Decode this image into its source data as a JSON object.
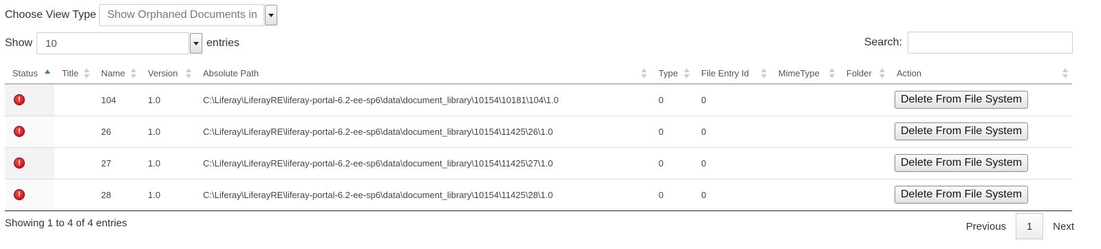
{
  "view_type": {
    "label": "Choose View Type",
    "selected": "Show Orphaned Documents in"
  },
  "length_menu": {
    "show_label": "Show",
    "selected": "10",
    "entries_label": "entries"
  },
  "search": {
    "label": "Search:",
    "value": ""
  },
  "table": {
    "columns": [
      "Status",
      "Title",
      "Name",
      "Version",
      "Absolute Path",
      "Type",
      "File Entry Id",
      "MimeType",
      "Folder",
      "Action"
    ],
    "rows": [
      {
        "status_icon": "error-icon",
        "title": "",
        "name": "104",
        "version": "1.0",
        "path": "C:\\Liferay\\LiferayRE\\liferay-portal-6.2-ee-sp6\\data\\document_library\\10154\\10181\\104\\1.0",
        "type": "0",
        "file_entry_id": "0",
        "mimetype": "",
        "folder": "",
        "action": "Delete From File System"
      },
      {
        "status_icon": "error-icon",
        "title": "",
        "name": "26",
        "version": "1.0",
        "path": "C:\\Liferay\\LiferayRE\\liferay-portal-6.2-ee-sp6\\data\\document_library\\10154\\11425\\26\\1.0",
        "type": "0",
        "file_entry_id": "0",
        "mimetype": "",
        "folder": "",
        "action": "Delete From File System"
      },
      {
        "status_icon": "error-icon",
        "title": "",
        "name": "27",
        "version": "1.0",
        "path": "C:\\Liferay\\LiferayRE\\liferay-portal-6.2-ee-sp6\\data\\document_library\\10154\\11425\\27\\1.0",
        "type": "0",
        "file_entry_id": "0",
        "mimetype": "",
        "folder": "",
        "action": "Delete From File System"
      },
      {
        "status_icon": "error-icon",
        "title": "",
        "name": "28",
        "version": "1.0",
        "path": "C:\\Liferay\\LiferayRE\\liferay-portal-6.2-ee-sp6\\data\\document_library\\10154\\11425\\28\\1.0",
        "type": "0",
        "file_entry_id": "0",
        "mimetype": "",
        "folder": "",
        "action": "Delete From File System"
      }
    ]
  },
  "footer": {
    "info": "Showing 1 to 4 of 4 entries",
    "previous": "Previous",
    "current_page": "1",
    "next": "Next"
  },
  "colors": {
    "sort_active": "#3d78c9",
    "error_icon": "#c41414"
  }
}
